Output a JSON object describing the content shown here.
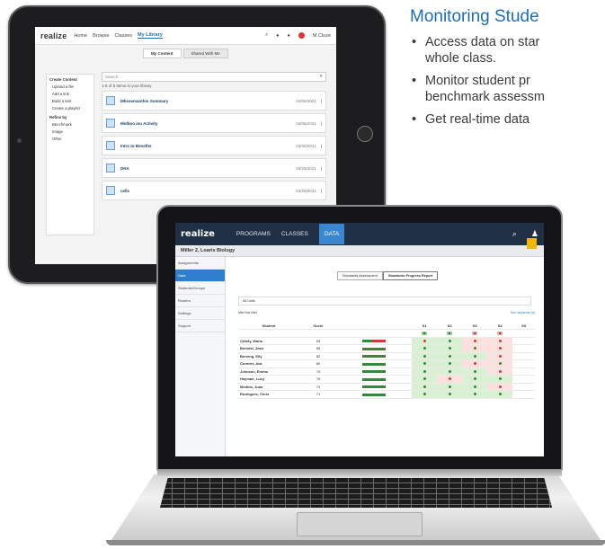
{
  "promo": {
    "title": "Monitoring Stude",
    "bullets": [
      "Access data on star",
      "whole class.",
      "Monitor student pr",
      "benchmark assessm",
      "Get real-time data"
    ]
  },
  "tablet": {
    "logo": "realize",
    "nav": [
      "Home",
      "Browse",
      "Classes",
      "My Library"
    ],
    "user": "M.Cluze",
    "tabs": [
      "My Content",
      "Shared With Me"
    ],
    "left_sections": [
      {
        "title": "Create Content",
        "rows": [
          "Upload a file",
          "Add a link",
          "Build a test",
          "Create a playlist"
        ]
      },
      {
        "title": "Refine by",
        "rows": [
          "Benchmark",
          "Image",
          "Other"
        ]
      }
    ],
    "search_placeholder": "Search",
    "sub": "1-5 of 5 items in your library",
    "rows": [
      {
        "name": "Mhssemanthin Summary",
        "date": "04/06/2021"
      },
      {
        "name": "Midboo inu Activity",
        "date": "04/06/2021"
      },
      {
        "name": "Intro to Benefits",
        "date": "03/30/2021"
      },
      {
        "name": "DNA",
        "date": "03/29/2021"
      },
      {
        "name": "cells",
        "date": "03/29/2021"
      }
    ]
  },
  "laptop": {
    "logo": "realize",
    "nav": [
      "PROGRAMS",
      "CLASSES",
      "DATA"
    ],
    "class_name": "Miller 2, Loaris Biology",
    "side_items": [
      "Assignments",
      "Data",
      "Students/Groups",
      "Rosters",
      "Settings",
      "Support"
    ],
    "buttons": [
      "Standards Assessment",
      "Standards Progress Report"
    ],
    "info": "All Units",
    "legend": "Met  Not Met",
    "sort": "Sort students by",
    "columns": [
      "Student",
      "Score",
      "S1",
      "S2",
      "S3",
      "S4",
      "S5"
    ],
    "rows": [
      {
        "name": "Charly, Maria",
        "v": "89",
        "bar": "mix"
      },
      {
        "name": "Benoist, Jean",
        "v": "85",
        "bar": "g"
      },
      {
        "name": "Berning, Elly",
        "v": "82",
        "bar": "g"
      },
      {
        "name": "Cormier, Ava",
        "v": "80",
        "bar": "g"
      },
      {
        "name": "Johnson, Emma",
        "v": "79",
        "bar": "g"
      },
      {
        "name": "Hayman, Lucy",
        "v": "76",
        "bar": "g"
      },
      {
        "name": "Medina, Juan",
        "v": "74",
        "bar": "g"
      },
      {
        "name": "Rodrigues, Chris",
        "v": "71",
        "bar": "g"
      }
    ]
  }
}
